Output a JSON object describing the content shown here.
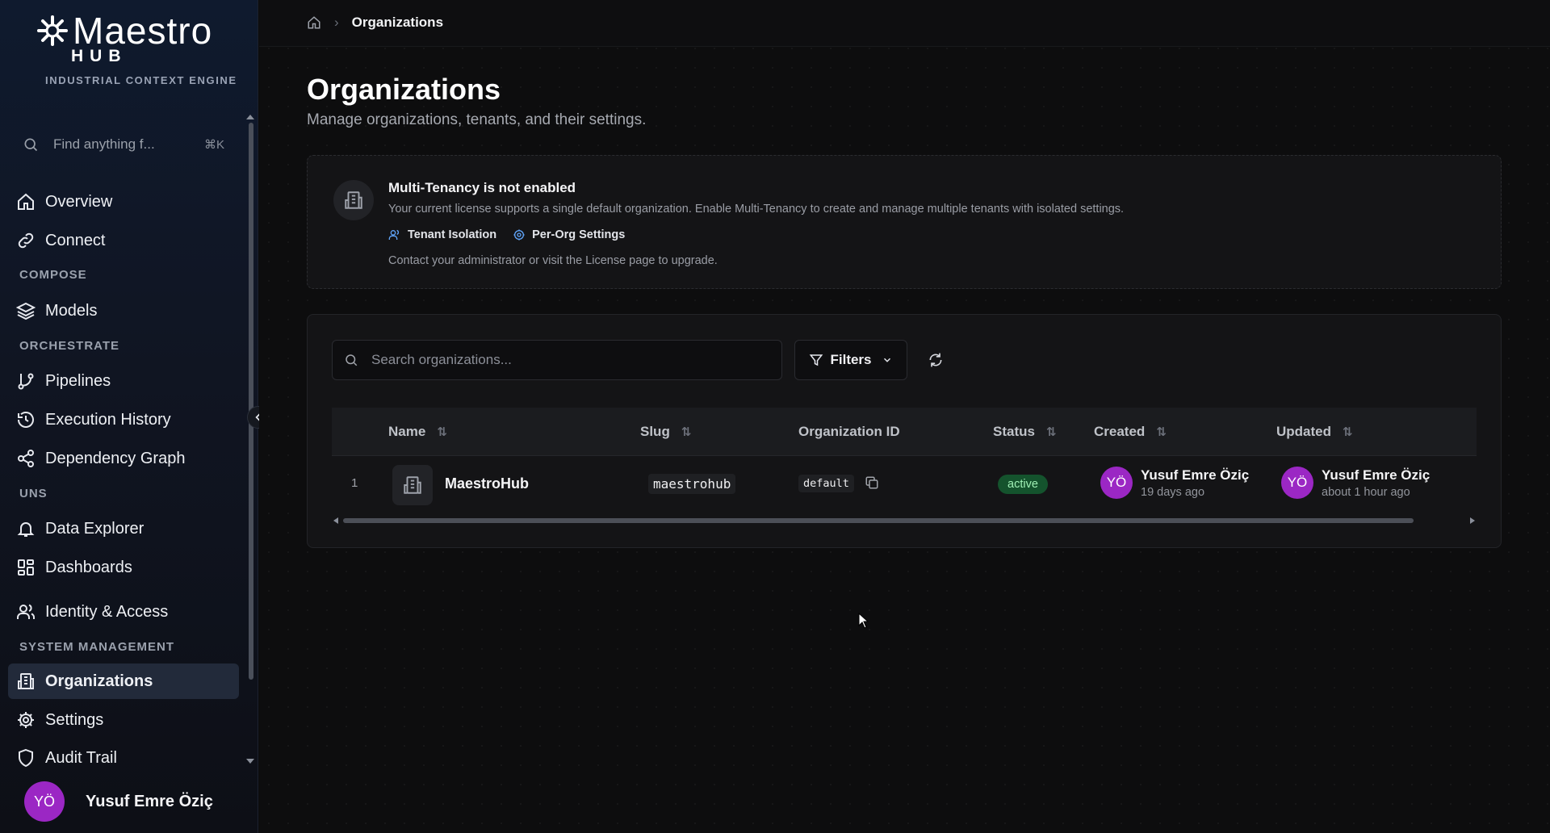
{
  "brand": {
    "name": "Maestro",
    "sub": "HUB",
    "tagline": "INDUSTRIAL CONTEXT ENGINE"
  },
  "sidebar": {
    "search_placeholder": "Find anything f...",
    "search_shortcut": "⌘K",
    "sections": {
      "compose": "COMPOSE",
      "orchestrate": "ORCHESTRATE",
      "uns": "UNS",
      "system": "SYSTEM MANAGEMENT"
    },
    "items": [
      {
        "label": "Overview",
        "icon": "home-icon"
      },
      {
        "label": "Connect",
        "icon": "link-icon"
      },
      {
        "label": "Models",
        "icon": "layers-icon"
      },
      {
        "label": "Pipelines",
        "icon": "git-branch-icon"
      },
      {
        "label": "Execution History",
        "icon": "history-icon"
      },
      {
        "label": "Dependency Graph",
        "icon": "share-icon"
      },
      {
        "label": "Data Explorer",
        "icon": "bell-icon"
      },
      {
        "label": "Dashboards",
        "icon": "grid-icon"
      },
      {
        "label": "Identity & Access",
        "icon": "users-icon"
      },
      {
        "label": "Organizations",
        "icon": "building-icon",
        "active": true
      },
      {
        "label": "Settings",
        "icon": "gear-icon"
      },
      {
        "label": "Audit Trail",
        "icon": "shield-icon"
      }
    ],
    "user": {
      "initials": "YÖ",
      "name": "Yusuf Emre Öziç"
    }
  },
  "breadcrumb": {
    "current": "Organizations"
  },
  "page": {
    "title": "Organizations",
    "subtitle": "Manage organizations, tenants, and their settings."
  },
  "notice": {
    "title": "Multi-Tenancy is not enabled",
    "text": "Your current license supports a single default organization. Enable Multi-Tenancy to create and manage multiple tenants with isolated settings.",
    "feature1": "Tenant Isolation",
    "feature2": "Per-Org Settings",
    "footer": "Contact your administrator or visit the License page to upgrade.",
    "accent": "#60a5fa"
  },
  "toolbar": {
    "search_placeholder": "Search organizations...",
    "filters_label": "Filters"
  },
  "table": {
    "columns": {
      "name": "Name",
      "slug": "Slug",
      "org_id": "Organization ID",
      "status": "Status",
      "created": "Created",
      "updated": "Updated"
    },
    "rows": [
      {
        "num": "1",
        "name": "MaestroHub",
        "slug": "maestrohub",
        "org_id": "default",
        "status": "active",
        "created_by": {
          "initials": "YÖ",
          "name": "Yusuf Emre Öziç",
          "time": "19 days ago"
        },
        "updated_by": {
          "initials": "YÖ",
          "name": "Yusuf Emre Öziç",
          "time": "about 1 hour ago"
        }
      }
    ]
  },
  "colors": {
    "avatar": "#9b27c4",
    "status_active_bg": "#14532d",
    "status_active_fg": "#9ff0b5"
  }
}
